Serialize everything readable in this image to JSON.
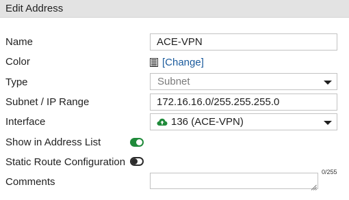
{
  "dialog": {
    "title": "Edit Address"
  },
  "fields": {
    "name": {
      "label": "Name",
      "value": "ACE-VPN"
    },
    "color": {
      "label": "Color",
      "link_label": "[Change]",
      "icon": "palette-icon"
    },
    "type": {
      "label": "Type",
      "value": "Subnet"
    },
    "subnet": {
      "label": "Subnet / IP Range",
      "value": "172.16.16.0/255.255.255.0"
    },
    "interface": {
      "label": "Interface",
      "value": "136 (ACE-VPN)",
      "icon": "cloud-upload-icon"
    },
    "show_in_address_list": {
      "label": "Show in Address List",
      "enabled": true
    },
    "static_route": {
      "label": "Static Route Configuration",
      "enabled": false
    },
    "comments": {
      "label": "Comments",
      "value": "",
      "counter": "0/255"
    }
  },
  "colors": {
    "title_bar_bg": "#e3e3e3",
    "link": "#1a5a9c",
    "toggle_on": "#1f8a3a",
    "cloud_icon": "#1f8a3a"
  }
}
